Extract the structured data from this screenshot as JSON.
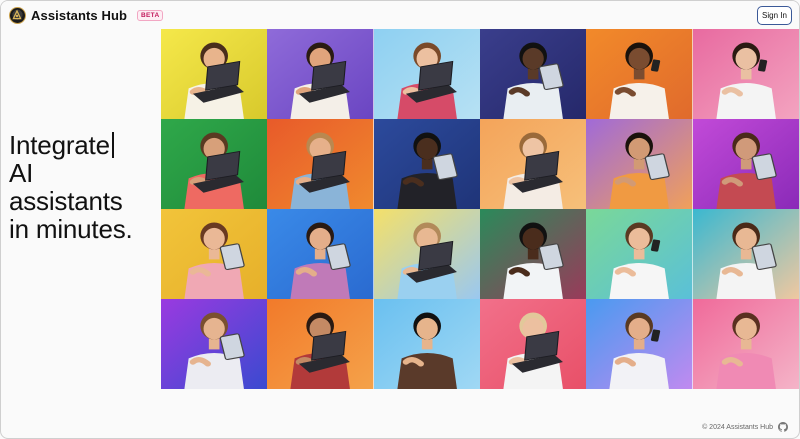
{
  "header": {
    "app_name": "Assistants Hub",
    "badge": "BETA",
    "signin_label": "Sign In"
  },
  "hero": {
    "lines": [
      "Integrate",
      "AI",
      "assistants",
      "in minutes."
    ]
  },
  "gallery": {
    "tiles": [
      {
        "bg1": "#f5e84a",
        "bg2": "#d8c92c",
        "skin": "#e8b48c",
        "shirt": "#f6f2e6",
        "hair": "#4a2e1c",
        "device": "laptop"
      },
      {
        "bg1": "#8f6bd9",
        "bg2": "#6a45c2",
        "skin": "#e0a47c",
        "shirt": "#f4efe8",
        "hair": "#2a1b12",
        "device": "laptop"
      },
      {
        "bg1": "#8ed0f2",
        "bg2": "#b7e1f3",
        "skin": "#ecc0a0",
        "shirt": "#d64b68",
        "hair": "#7a4a2a",
        "device": "laptop"
      },
      {
        "bg1": "#3a3e8c",
        "bg2": "#25286a",
        "skin": "#5a3a28",
        "shirt": "#e9eef2",
        "hair": "#111111",
        "device": "tablet"
      },
      {
        "bg1": "#f28a2a",
        "bg2": "#e06a2c",
        "skin": "#7a4c30",
        "shirt": "#f6f1ea",
        "hair": "#1a120c",
        "device": "phone"
      },
      {
        "bg1": "#e86aa0",
        "bg2": "#f3a4c0",
        "skin": "#eac0a2",
        "shirt": "#f4f4f4",
        "hair": "#2b1a12",
        "device": "phone"
      },
      {
        "bg1": "#2fa84a",
        "bg2": "#1f8a3a",
        "skin": "#d7a07a",
        "shirt": "#ee6a62",
        "hair": "#5a3a22",
        "device": "laptop"
      },
      {
        "bg1": "#e85a2a",
        "bg2": "#f08a2e",
        "skin": "#e6b08a",
        "shirt": "#8ab4d8",
        "hair": "#b98850",
        "device": "laptop"
      },
      {
        "bg1": "#2c4a9c",
        "bg2": "#1f3478",
        "skin": "#4a2e1e",
        "shirt": "#222228",
        "hair": "#111111",
        "device": "tablet"
      },
      {
        "bg1": "#f4a45a",
        "bg2": "#f6c07a",
        "skin": "#eec4a4",
        "shirt": "#f4ece4",
        "hair": "#9a6a3a",
        "device": "laptop"
      },
      {
        "bg1": "#a06ad8",
        "bg2": "#f0a05a",
        "skin": "#d29a74",
        "shirt": "#f09a42",
        "hair": "#1a120c",
        "device": "tablet"
      },
      {
        "bg1": "#c24ad8",
        "bg2": "#8a2ab8",
        "skin": "#d09a7a",
        "shirt": "#c44a52",
        "hair": "#4a2a1a",
        "device": "tablet"
      },
      {
        "bg1": "#f2c43a",
        "bg2": "#e6b02a",
        "skin": "#eab896",
        "shirt": "#f0a8b4",
        "hair": "#6a3a22",
        "device": "tablet"
      },
      {
        "bg1": "#3a8ae8",
        "bg2": "#2a6ad0",
        "skin": "#e4ae8a",
        "shirt": "#c07ab8",
        "hair": "#2a1a12",
        "device": "tablet"
      },
      {
        "bg1": "#f4e06a",
        "bg2": "#9ac8f0",
        "skin": "#e8b892",
        "shirt": "#9ad0f0",
        "hair": "#b28a5a",
        "device": "laptop"
      },
      {
        "bg1": "#2a8a5a",
        "bg2": "#9a3a5a",
        "skin": "#4a2c1c",
        "shirt": "#f2f4f6",
        "hair": "#111111",
        "device": "tablet"
      },
      {
        "bg1": "#7ad898",
        "bg2": "#5ac0d8",
        "skin": "#ebbc9a",
        "shirt": "#f6f6f6",
        "hair": "#5a3a22",
        "device": "phone"
      },
      {
        "bg1": "#3ab8d0",
        "bg2": "#f0c8a0",
        "skin": "#e8b894",
        "shirt": "#f4f4f4",
        "hair": "#4a2a18",
        "device": "tablet"
      },
      {
        "bg1": "#9a3ae0",
        "bg2": "#3a4ad0",
        "skin": "#e6b490",
        "shirt": "#ececf2",
        "hair": "#7a5030",
        "device": "tablet"
      },
      {
        "bg1": "#f27a2a",
        "bg2": "#f4a24a",
        "skin": "#c48a64",
        "shirt": "#b23a3a",
        "hair": "#2a1a12",
        "device": "laptop"
      },
      {
        "bg1": "#6ac0f0",
        "bg2": "#a0d8f4",
        "skin": "#e6b48c",
        "shirt": "#5a3a2a",
        "hair": "#111111",
        "device": "none"
      },
      {
        "bg1": "#f2708a",
        "bg2": "#e85068",
        "skin": "#ecc0a0",
        "shirt": "#f4f4f4",
        "hair": "#e2c89a",
        "device": "laptop"
      },
      {
        "bg1": "#4a9af0",
        "bg2": "#c08af0",
        "skin": "#e4ae8a",
        "shirt": "#f2f2f6",
        "hair": "#5a3a22",
        "device": "phone"
      },
      {
        "bg1": "#f06a9a",
        "bg2": "#f4b4c8",
        "skin": "#e8b894",
        "shirt": "#f08ab4",
        "hair": "#5a3020",
        "device": "none"
      }
    ]
  },
  "footer": {
    "copyright": "© 2024 Assistants Hub"
  }
}
